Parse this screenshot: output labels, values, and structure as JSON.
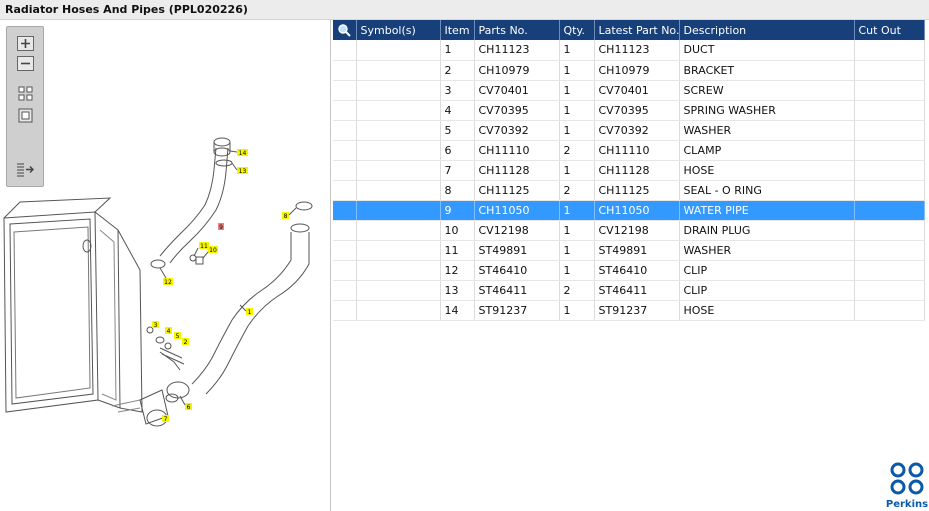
{
  "window": {
    "title": "Radiator Hoses And Pipes (PPL020226)"
  },
  "toolbar": {
    "zoom_in_icon": "plus-icon",
    "zoom_out_icon": "minus-icon",
    "fit_icon": "grid-icon",
    "actual_icon": "square-icon",
    "export_icon": "list-arrow-icon"
  },
  "diagram": {
    "callouts": [
      "14",
      "13",
      "9",
      "8",
      "11",
      "10",
      "12",
      "1",
      "3",
      "4",
      "5",
      "2",
      "6",
      "7"
    ]
  },
  "table": {
    "columns": [
      "Symbol(s)",
      "Item",
      "Parts No.",
      "Qty.",
      "Latest Part No.",
      "Description",
      "Cut Out"
    ],
    "selected_row": 8,
    "rows": [
      {
        "item": "1",
        "part": "CH11123",
        "qty": "1",
        "latest": "CH11123",
        "desc": "DUCT"
      },
      {
        "item": "2",
        "part": "CH10979",
        "qty": "1",
        "latest": "CH10979",
        "desc": "BRACKET"
      },
      {
        "item": "3",
        "part": "CV70401",
        "qty": "1",
        "latest": "CV70401",
        "desc": "SCREW"
      },
      {
        "item": "4",
        "part": "CV70395",
        "qty": "1",
        "latest": "CV70395",
        "desc": "SPRING WASHER"
      },
      {
        "item": "5",
        "part": "CV70392",
        "qty": "1",
        "latest": "CV70392",
        "desc": "WASHER"
      },
      {
        "item": "6",
        "part": "CH11110",
        "qty": "2",
        "latest": "CH11110",
        "desc": "CLAMP"
      },
      {
        "item": "7",
        "part": "CH11128",
        "qty": "1",
        "latest": "CH11128",
        "desc": "HOSE"
      },
      {
        "item": "8",
        "part": "CH11125",
        "qty": "2",
        "latest": "CH11125",
        "desc": "SEAL - O RING"
      },
      {
        "item": "9",
        "part": "CH11050",
        "qty": "1",
        "latest": "CH11050",
        "desc": "WATER PIPE"
      },
      {
        "item": "10",
        "part": "CV12198",
        "qty": "1",
        "latest": "CV12198",
        "desc": "DRAIN PLUG"
      },
      {
        "item": "11",
        "part": "ST49891",
        "qty": "1",
        "latest": "ST49891",
        "desc": "WASHER"
      },
      {
        "item": "12",
        "part": "ST46410",
        "qty": "1",
        "latest": "ST46410",
        "desc": "CLIP"
      },
      {
        "item": "13",
        "part": "ST46411",
        "qty": "2",
        "latest": "ST46411",
        "desc": "CLIP"
      },
      {
        "item": "14",
        "part": "ST91237",
        "qty": "1",
        "latest": "ST91237",
        "desc": "HOSE"
      }
    ]
  },
  "brand": {
    "name": "Perkins",
    "color": "#0b5aa8",
    "header_color": "#173f7a",
    "selection_color": "#3399ff"
  }
}
